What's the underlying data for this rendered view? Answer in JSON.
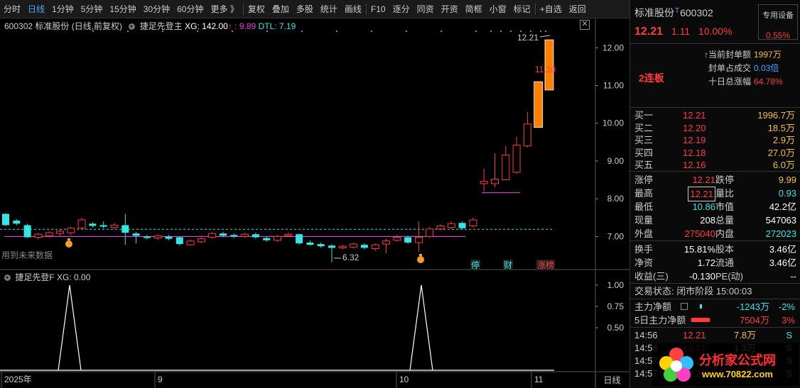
{
  "toolbar": {
    "items": [
      "分时",
      "日线",
      "1分钟",
      "5分钟",
      "15分钟",
      "30分钟",
      "60分钟",
      "更多 》",
      "复权",
      "叠加",
      "多股",
      "统计",
      "画线",
      "F10",
      "逐分",
      "同资",
      "开资",
      "简框",
      "小窗",
      "标记",
      "+自选",
      "返回"
    ],
    "active": "日线"
  },
  "chart": {
    "code": "600302",
    "name_period": "标准股份 (日线,前复权)",
    "indicator": "捷足先登主",
    "xg_label": "XG: 142.00",
    "xg_arrow": "↑",
    "xg_value": ": 9.89",
    "dtl": "DTL: 7.19",
    "close_icon": "✕",
    "hint": "用到未来数据",
    "sub_indicator": "捷足先登F",
    "sub_xg": "XG: 0.00",
    "price_axis": [
      "12.00",
      "11.00",
      "10.00",
      "9.00",
      "8.00",
      "7.00"
    ],
    "sub_axis": [
      "1.00",
      "0.75",
      "0.50"
    ],
    "date_axis": [
      "2025年",
      "9",
      "10",
      "11"
    ],
    "period_label": "日线",
    "max_label": "12.21",
    "mid_label": "11.10",
    "min_label": "6.32",
    "markers": [
      "停",
      "财",
      "涨榜"
    ],
    "colors": {
      "up": "#ff3b3b",
      "down": "#35e6e6",
      "limit": "#ff8000",
      "ma": "#e040e0",
      "dash": "#35e6e6"
    }
  },
  "chart_data": {
    "type": "candlestick",
    "title": "600302 标准股份 (日线,前复权)",
    "ylim": [
      6.2,
      12.4
    ],
    "candles": [
      [
        7.6,
        7.3,
        7.62,
        7.28
      ],
      [
        7.42,
        7.34,
        7.46,
        7.3
      ],
      [
        7.3,
        6.98,
        7.34,
        6.96
      ],
      [
        6.98,
        7.06,
        7.1,
        6.92
      ],
      [
        7.02,
        7.1,
        7.14,
        6.98
      ],
      [
        7.08,
        7.14,
        7.18,
        7.02
      ],
      [
        7.1,
        7.22,
        7.26,
        7.04
      ],
      [
        7.22,
        7.44,
        7.5,
        7.18
      ],
      [
        7.34,
        7.28,
        7.38,
        7.24
      ],
      [
        7.3,
        7.26,
        7.4,
        7.22
      ],
      [
        7.24,
        7.3,
        7.36,
        7.2
      ],
      [
        7.3,
        7.1,
        7.6,
        6.78
      ],
      [
        7.08,
        7.02,
        7.12,
        6.82
      ],
      [
        7.0,
        6.96,
        7.04,
        6.92
      ],
      [
        6.96,
        7.02,
        7.06,
        6.9
      ],
      [
        7.0,
        6.94,
        7.04,
        6.9
      ],
      [
        6.98,
        6.8,
        7.0,
        6.76
      ],
      [
        6.78,
        6.88,
        6.92,
        6.76
      ],
      [
        6.86,
        6.94,
        6.98,
        6.82
      ],
      [
        6.98,
        7.08,
        7.12,
        6.94
      ],
      [
        7.08,
        7.02,
        7.12,
        6.98
      ],
      [
        7.04,
        7.0,
        7.08,
        6.96
      ],
      [
        7.0,
        7.06,
        7.1,
        6.96
      ],
      [
        7.06,
        6.98,
        7.1,
        6.94
      ],
      [
        6.96,
        6.9,
        7.0,
        6.86
      ],
      [
        6.9,
        7.0,
        7.04,
        6.86
      ],
      [
        7.02,
        7.06,
        7.1,
        6.98
      ],
      [
        7.06,
        6.82,
        7.08,
        6.78
      ],
      [
        6.84,
        6.78,
        6.9,
        6.76
      ],
      [
        6.8,
        6.74,
        6.84,
        6.7
      ],
      [
        6.76,
        6.7,
        6.8,
        6.32
      ],
      [
        6.7,
        6.74,
        6.78,
        6.66
      ],
      [
        6.72,
        6.8,
        6.84,
        6.68
      ],
      [
        6.78,
        6.7,
        6.82,
        6.66
      ],
      [
        6.68,
        6.78,
        6.82,
        6.62
      ],
      [
        6.8,
        6.88,
        6.94,
        6.56
      ],
      [
        6.9,
        6.98,
        7.04,
        6.86
      ],
      [
        6.98,
        6.84,
        7.02,
        6.8
      ],
      [
        6.84,
        6.98,
        7.4,
        6.6
      ],
      [
        7.0,
        7.2,
        7.26,
        6.96
      ],
      [
        7.2,
        7.28,
        7.32,
        7.16
      ],
      [
        7.24,
        7.34,
        7.4,
        7.2
      ],
      [
        7.36,
        7.22,
        7.4,
        7.18
      ],
      [
        7.28,
        7.44,
        7.5,
        7.24
      ],
      [
        8.4,
        8.46,
        8.8,
        8.2
      ],
      [
        8.4,
        8.52,
        9.2,
        8.3
      ],
      [
        8.5,
        9.16,
        9.4,
        8.5
      ],
      [
        8.7,
        9.42,
        9.64,
        8.66
      ],
      [
        9.4,
        9.98,
        10.3,
        9.36
      ],
      [
        9.89,
        11.1,
        11.1,
        9.89
      ],
      [
        10.88,
        12.21,
        12.21,
        10.88
      ]
    ],
    "sub_peaks": [
      4,
      37
    ]
  },
  "panel": {
    "name": "标准股份",
    "t_mark": "T",
    "code": "600302",
    "device_label": "专用设备",
    "device_pct": "0.55%",
    "price": "12.21",
    "change": "1.11",
    "change_pct": "10.00%",
    "lianban": "2连板",
    "seal": [
      {
        "k": "↑当前封单额",
        "v": "1997万",
        "c": "yellow"
      },
      {
        "k": "封单占成交",
        "v": "0.03倍",
        "c": "blue"
      },
      {
        "k": "十日总涨幅",
        "v": "64.78%",
        "c": "red"
      }
    ],
    "book": [
      {
        "k": "买一",
        "p": "12.21",
        "v": "1996.7万"
      },
      {
        "k": "买二",
        "p": "12.20",
        "v": "18.5万"
      },
      {
        "k": "买三",
        "p": "12.19",
        "v": "2.9万"
      },
      {
        "k": "买四",
        "p": "12.18",
        "v": "27.0万"
      },
      {
        "k": "买五",
        "p": "12.16",
        "v": "6.0万"
      }
    ],
    "stats": [
      {
        "k": "涨停",
        "v": "12.21",
        "c": "red"
      },
      {
        "k": "跌停",
        "v": "9.99",
        "c": "yellow"
      },
      {
        "k": "最高",
        "v": "12.21",
        "c": "red"
      },
      {
        "k": "量比",
        "v": "0.93",
        "c": "green"
      },
      {
        "k": "最低",
        "v": "10.86",
        "c": "green"
      },
      {
        "k": "市值",
        "v": "42.2亿",
        "c": "white"
      },
      {
        "k": "现量",
        "v": "208",
        "c": "white"
      },
      {
        "k": "总量",
        "v": "547063",
        "c": "white"
      },
      {
        "k": "外盘",
        "v": "275040",
        "c": "red"
      },
      {
        "k": "内盘",
        "v": "272023",
        "c": "green"
      }
    ],
    "stats2": [
      {
        "k": "换手",
        "v": "15.81%",
        "c": "white"
      },
      {
        "k": "股本",
        "v": "3.46亿",
        "c": "white"
      },
      {
        "k": "净资",
        "v": "1.72",
        "c": "white"
      },
      {
        "k": "流通",
        "v": "3.46亿",
        "c": "white"
      },
      {
        "k": "收益(三)",
        "v": "-0.130",
        "c": "white"
      },
      {
        "k": "PE(动)",
        "v": "--",
        "c": "white"
      }
    ],
    "trade_status": "交易状态: 闭市阶段 15:00:03",
    "flow": [
      {
        "k": "主力净额",
        "amt": "-1243万",
        "pct": "-2%",
        "c": "green"
      },
      {
        "k": "5日主力净额",
        "amt": "7504万",
        "pct": "3%",
        "c": "red"
      }
    ],
    "ticks": [
      {
        "t": "14:56",
        "p": "12.21",
        "v": "7.8万",
        "s": "S"
      },
      {
        "t": "14:56",
        "p": "12.21",
        "v": "1.3万",
        "s": "S"
      },
      {
        "t": "14:57",
        "p": "12.21",
        "v": "6.2万",
        "s": "S"
      },
      {
        "t": "14:57",
        "p": "12.21",
        "v": "3.1万",
        "s": "S"
      }
    ],
    "watermark_title": "分析家公式网",
    "watermark_url": "www.70822.com"
  }
}
